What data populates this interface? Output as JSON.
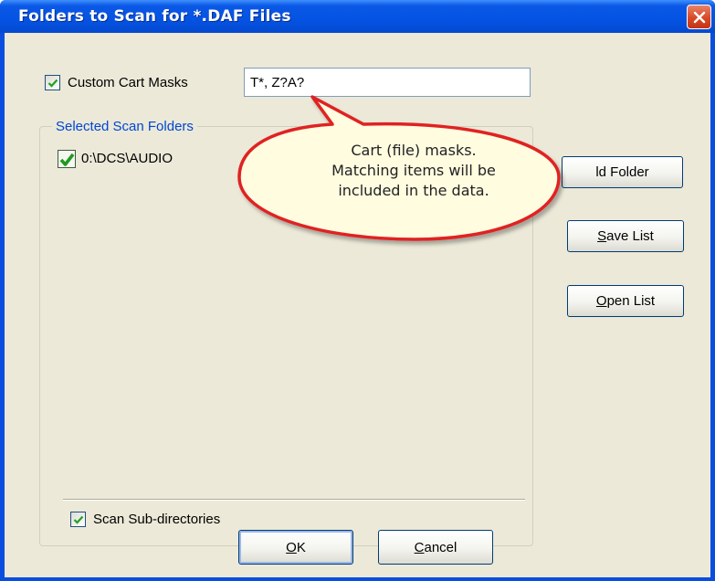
{
  "window": {
    "title": "Folders to Scan for *.DAF Files"
  },
  "custom_masks": {
    "label": "Custom Cart Masks",
    "checked": true,
    "value": "T*, Z?A?"
  },
  "scan_folders": {
    "legend": "Selected Scan Folders",
    "items": [
      {
        "path": "0:\\DCS\\AUDIO",
        "checked": true
      }
    ]
  },
  "subdirs": {
    "label": "Scan Sub-directories",
    "checked": true
  },
  "side_buttons": {
    "add_folder": "ld Folder",
    "save_list_accel": "S",
    "save_list_rest": "ave List",
    "open_list_accel": "O",
    "open_list_rest": "pen List"
  },
  "dialog_buttons": {
    "ok_accel": "O",
    "ok_rest": "K",
    "cancel_accel": "C",
    "cancel_rest": "ancel"
  },
  "callout": {
    "line1": "Cart (file) masks.",
    "line2": "Matching items will be",
    "line3": "included in the data."
  },
  "colors": {
    "titlebar": "#0553e3",
    "dialog_bg": "#ece9d8",
    "legend": "#0046d5",
    "callout_border": "#e02020",
    "callout_fill": "#fffce0"
  }
}
